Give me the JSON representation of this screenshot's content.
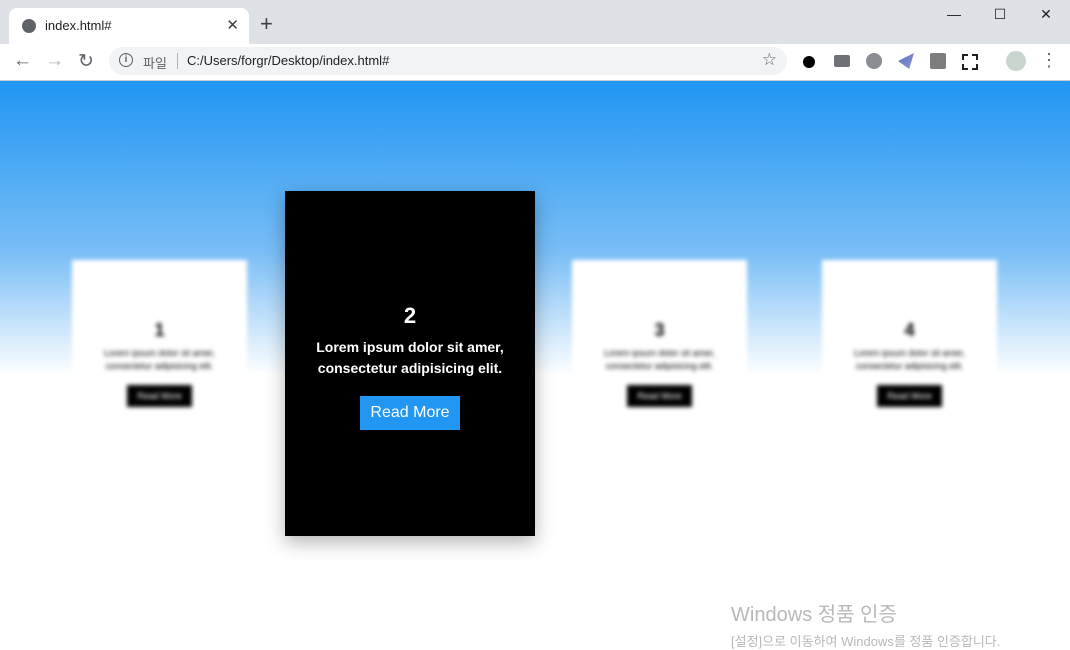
{
  "browser": {
    "tab_title": "index.html#",
    "tab_close": "✕",
    "new_tab": "+",
    "window_controls": {
      "minimize": "—",
      "maximize": "☐",
      "close": "✕"
    },
    "nav": {
      "back": "←",
      "forward": "→",
      "reload": "↻"
    },
    "address": {
      "scheme_label": "파일",
      "url": "C:/Users/forgr/Desktop/index.html#"
    },
    "bookmark_star": "☆",
    "menu": "⋮"
  },
  "cards": [
    {
      "number": "1",
      "text": "Lorem ipsum dolor sit amer, consectetur adipisicing elit.",
      "button": "Read More"
    },
    {
      "number": "2",
      "text": "Lorem ipsum dolor sit amer, consectetur adipisicing elit.",
      "button": "Read More"
    },
    {
      "number": "3",
      "text": "Lorem ipsum dolor sit amer, consectetur adipisicing elit.",
      "button": "Read More"
    },
    {
      "number": "4",
      "text": "Lorem ipsum dolor sit amer, consectetur adipisicing elit.",
      "button": "Read More"
    }
  ],
  "watermark": {
    "title": "Windows 정품 인증",
    "subtitle": "[설정]으로 이동하여 Windows를 정품 인증합니다."
  },
  "colors": {
    "accent": "#2196f3",
    "active_card": "#000000",
    "chrome": "#dee1e6"
  }
}
